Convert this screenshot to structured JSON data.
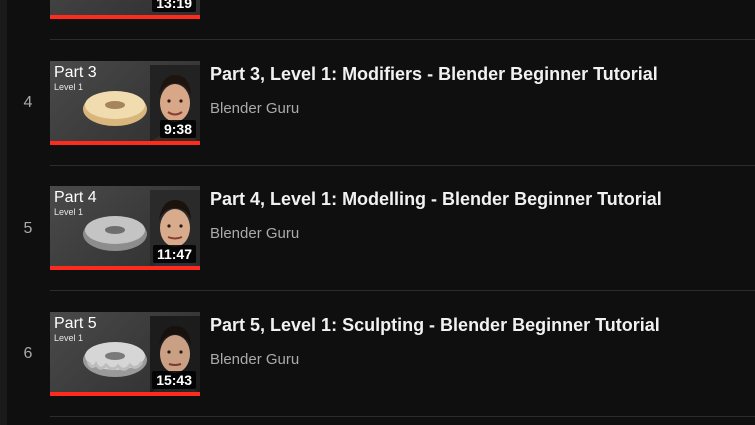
{
  "playlist": {
    "top_item": {
      "duration": "13:19",
      "watched_fraction": 1.0
    },
    "items": [
      {
        "index": "4",
        "thumb_part": "Part 3",
        "thumb_level": "Level 1",
        "duration": "9:38",
        "title": "Part 3, Level 1: Modifiers - Blender Beginner Tutorial",
        "channel": "Blender Guru",
        "watched_fraction": 1.0,
        "donut_style": "glazed"
      },
      {
        "index": "5",
        "thumb_part": "Part 4",
        "thumb_level": "Level 1",
        "duration": "11:47",
        "title": "Part 4, Level 1: Modelling - Blender Beginner Tutorial",
        "channel": "Blender Guru",
        "watched_fraction": 1.0,
        "donut_style": "grey"
      },
      {
        "index": "6",
        "thumb_part": "Part 5",
        "thumb_level": "Level 1",
        "duration": "15:43",
        "title": "Part 5, Level 1: Sculpting - Blender Beginner Tutorial",
        "channel": "Blender Guru",
        "watched_fraction": 1.0,
        "donut_style": "grey-drip"
      }
    ]
  },
  "colors": {
    "background": "#0f0f0f",
    "progress": "#ff2b1c",
    "title_text": "#f1f1f1",
    "secondary_text": "#aaaaaa"
  }
}
